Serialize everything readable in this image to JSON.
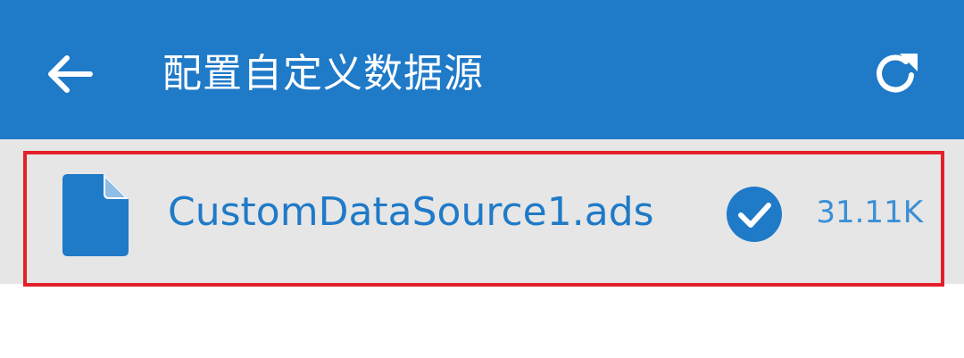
{
  "colors": {
    "toolbar_bg": "#1f7ac8",
    "accent": "#1f7ac8",
    "list_bg": "#e6e6e6",
    "highlight_border": "#e3202a",
    "size_text": "#3a8fd6"
  },
  "toolbar": {
    "back_icon": "arrow-left-icon",
    "title": "配置自定义数据源",
    "refresh_icon": "refresh-icon"
  },
  "files": [
    {
      "icon": "file-icon",
      "name": "CustomDataSource1.ads",
      "status_icon": "check-circle-icon",
      "size": "31.11K"
    }
  ]
}
